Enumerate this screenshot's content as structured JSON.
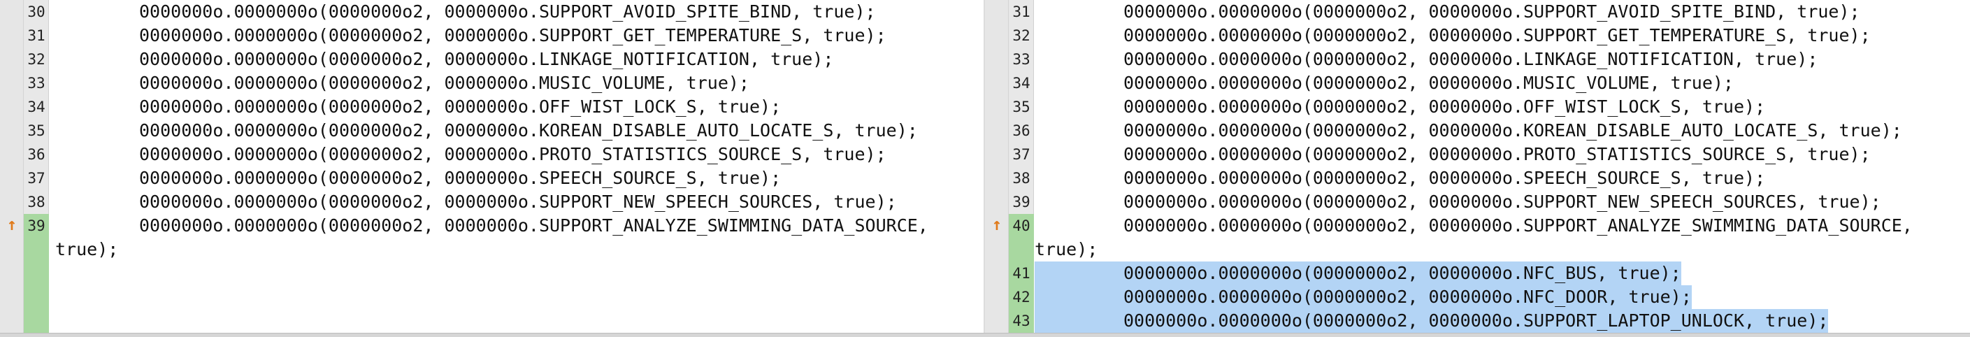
{
  "left": {
    "lines": [
      {
        "no": "30",
        "text": "0000000o.0000000o(0000000o2, 0000000o.SUPPORT_AVOID_SPITE_BIND, true);"
      },
      {
        "no": "31",
        "text": "0000000o.0000000o(0000000o2, 0000000o.SUPPORT_GET_TEMPERATURE_S, true);"
      },
      {
        "no": "32",
        "text": "0000000o.0000000o(0000000o2, 0000000o.LINKAGE_NOTIFICATION, true);"
      },
      {
        "no": "33",
        "text": "0000000o.0000000o(0000000o2, 0000000o.MUSIC_VOLUME, true);"
      },
      {
        "no": "34",
        "text": "0000000o.0000000o(0000000o2, 0000000o.OFF_WIST_LOCK_S, true);"
      },
      {
        "no": "35",
        "text": "0000000o.0000000o(0000000o2, 0000000o.KOREAN_DISABLE_AUTO_LOCATE_S, true);"
      },
      {
        "no": "36",
        "text": "0000000o.0000000o(0000000o2, 0000000o.PROTO_STATISTICS_SOURCE_S, true);"
      },
      {
        "no": "37",
        "text": "0000000o.0000000o(0000000o2, 0000000o.SPEECH_SOURCE_S, true);"
      },
      {
        "no": "38",
        "text": "0000000o.0000000o(0000000o2, 0000000o.SUPPORT_NEW_SPEECH_SOURCES, true);"
      },
      {
        "no": "39",
        "text": "0000000o.0000000o(0000000o2, 0000000o.SUPPORT_ANALYZE_SWIMMING_DATA_SOURCE,"
      }
    ],
    "wrap": "true);"
  },
  "right": {
    "lines": [
      {
        "no": "31",
        "text": "0000000o.0000000o(0000000o2, 0000000o.SUPPORT_AVOID_SPITE_BIND, true);"
      },
      {
        "no": "32",
        "text": "0000000o.0000000o(0000000o2, 0000000o.SUPPORT_GET_TEMPERATURE_S, true);"
      },
      {
        "no": "33",
        "text": "0000000o.0000000o(0000000o2, 0000000o.LINKAGE_NOTIFICATION, true);"
      },
      {
        "no": "34",
        "text": "0000000o.0000000o(0000000o2, 0000000o.MUSIC_VOLUME, true);"
      },
      {
        "no": "35",
        "text": "0000000o.0000000o(0000000o2, 0000000o.OFF_WIST_LOCK_S, true);"
      },
      {
        "no": "36",
        "text": "0000000o.0000000o(0000000o2, 0000000o.KOREAN_DISABLE_AUTO_LOCATE_S, true);"
      },
      {
        "no": "37",
        "text": "0000000o.0000000o(0000000o2, 0000000o.PROTO_STATISTICS_SOURCE_S, true);"
      },
      {
        "no": "38",
        "text": "0000000o.0000000o(0000000o2, 0000000o.SPEECH_SOURCE_S, true);"
      },
      {
        "no": "39",
        "text": "0000000o.0000000o(0000000o2, 0000000o.SUPPORT_NEW_SPEECH_SOURCES, true);"
      },
      {
        "no": "40",
        "text": "0000000o.0000000o(0000000o2, 0000000o.SUPPORT_ANALYZE_SWIMMING_DATA_SOURCE,"
      }
    ],
    "wrap": "true);",
    "added": [
      {
        "no": "41",
        "text": "0000000o.0000000o(0000000o2, 0000000o.NFC_BUS, true);"
      },
      {
        "no": "42",
        "text": "0000000o.0000000o(0000000o2, 0000000o.NFC_DOOR, true);"
      },
      {
        "no": "43",
        "text": "0000000o.0000000o(0000000o2, 0000000o.SUPPORT_LAPTOP_UNLOCK, true);"
      }
    ]
  },
  "colors": {
    "changed_gutter": "#a8d8a0",
    "added_highlight": "#b3d4f5",
    "arrow": "#e07a1a"
  },
  "icons": {
    "change_marker": "up-arrow-icon"
  }
}
